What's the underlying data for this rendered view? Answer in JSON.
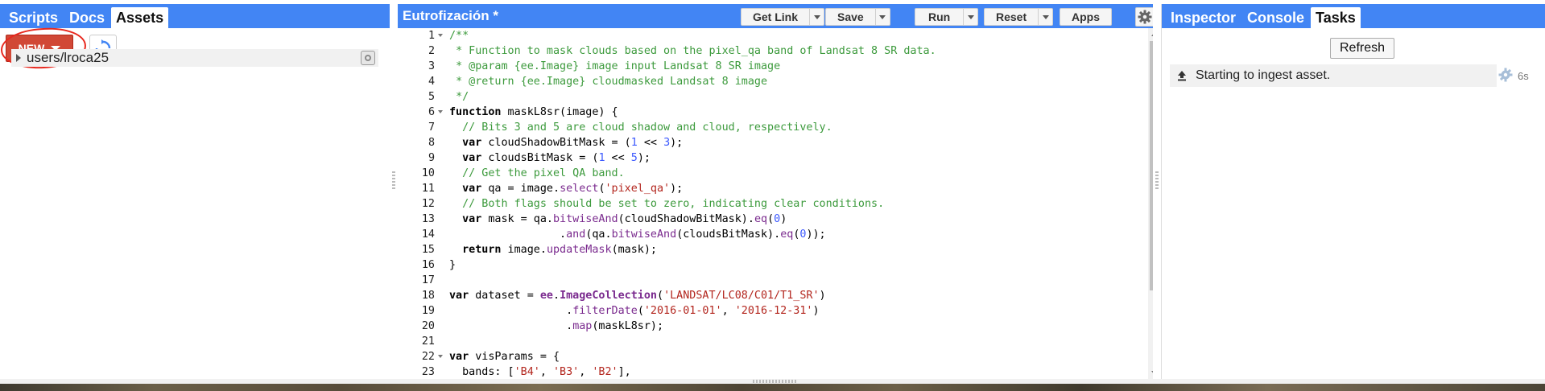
{
  "left_panel": {
    "tabs": [
      {
        "label": "Scripts",
        "active": false
      },
      {
        "label": "Docs",
        "active": false
      },
      {
        "label": "Assets",
        "active": true
      }
    ],
    "new_button_label": "NEW",
    "assets": [
      {
        "label": "users/lroca25"
      }
    ]
  },
  "center_panel": {
    "title": "Eutrofización *",
    "buttons": {
      "get_link": "Get Link",
      "save": "Save",
      "run": "Run",
      "reset": "Reset",
      "apps": "Apps"
    },
    "line_numbers": [
      "1",
      "2",
      "3",
      "4",
      "5",
      "6",
      "7",
      "8",
      "9",
      "10",
      "11",
      "12",
      "13",
      "14",
      "15",
      "16",
      "17",
      "18",
      "19",
      "20",
      "21",
      "22",
      "23"
    ],
    "code_lines": [
      "/**",
      " * Function to mask clouds based on the pixel_qa band of Landsat 8 SR data.",
      " * @param {ee.Image} image input Landsat 8 SR image",
      " * @return {ee.Image} cloudmasked Landsat 8 image",
      " */",
      "function maskL8sr(image) {",
      "  // Bits 3 and 5 are cloud shadow and cloud, respectively.",
      "  var cloudShadowBitMask = (1 << 3);",
      "  var cloudsBitMask = (1 << 5);",
      "  // Get the pixel QA band.",
      "  var qa = image.select('pixel_qa');",
      "  // Both flags should be set to zero, indicating clear conditions.",
      "  var mask = qa.bitwiseAnd(cloudShadowBitMask).eq(0)",
      "                 .and(qa.bitwiseAnd(cloudsBitMask).eq(0));",
      "  return image.updateMask(mask);",
      "}",
      "",
      "var dataset = ee.ImageCollection('LANDSAT/LC08/C01/T1_SR')",
      "                  .filterDate('2016-01-01', '2016-12-31')",
      "                  .map(maskL8sr);",
      "",
      "var visParams = {",
      "  bands: ['B4', 'B3', 'B2'],"
    ]
  },
  "right_panel": {
    "tabs": [
      {
        "label": "Inspector",
        "active": false
      },
      {
        "label": "Console",
        "active": false
      },
      {
        "label": "Tasks",
        "active": true
      }
    ],
    "refresh_label": "Refresh",
    "tasks": [
      {
        "label": "Starting to ingest asset.",
        "elapsed": "6s"
      }
    ]
  },
  "colors": {
    "header_blue": "#4285f4",
    "new_button_red": "#d14836",
    "annotation_red": "#e8281e",
    "comment_green": "#3c9a3c",
    "string_red": "#b3261e",
    "number_blue": "#3d5afe"
  },
  "icons": [
    "refresh-icon",
    "caret-down-icon",
    "gear-icon",
    "upload-icon",
    "spinner-gear-icon",
    "info-icon"
  ]
}
